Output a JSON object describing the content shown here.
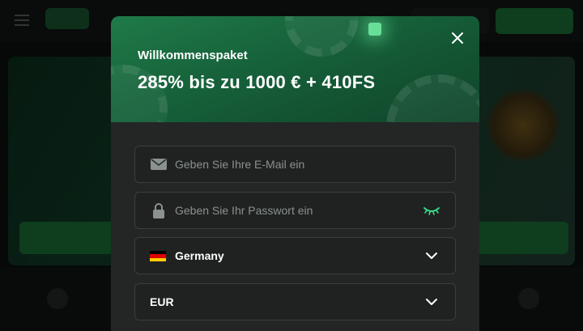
{
  "promo": {
    "label": "Willkommenspaket",
    "title": "285% bis zu 1000 € + 410FS"
  },
  "form": {
    "email_placeholder": "Geben Sie Ihre E-Mail ein",
    "password_placeholder": "Geben Sie Ihr Passwort ein",
    "country": "Germany",
    "currency": "EUR"
  },
  "icons": {
    "close": "close-icon",
    "email": "envelope-icon",
    "password": "lock-icon",
    "toggle_password": "eye-closed-icon",
    "country_flag": "germany-flag-icon",
    "dropdown": "chevron-down-icon"
  },
  "colors": {
    "brand_green": "#1f8a44",
    "accent_eye": "#39d98a",
    "modal_bg": "#232625"
  }
}
